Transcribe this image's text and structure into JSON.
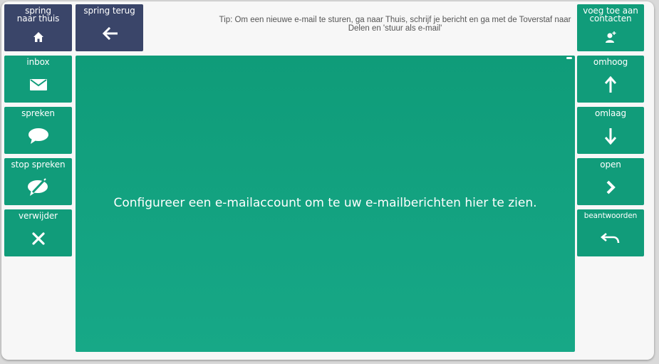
{
  "top_left": [
    {
      "label": "spring naar thuis",
      "icon": "home-icon"
    },
    {
      "label": "spring terug",
      "icon": "arrow-left-icon"
    }
  ],
  "tip": "Tip: Om een nieuwe e-mail te sturen, ga naar Thuis, schrijf je bericht en ga met de Toverstaf naar Delen en 'stuur als e-mail'",
  "left_buttons": [
    {
      "label": "inbox",
      "icon": "envelope-icon"
    },
    {
      "label": "spreken",
      "icon": "speech-bubble-icon"
    },
    {
      "label": "stop spreken",
      "icon": "speech-bubble-slash-icon"
    },
    {
      "label": "verwijder",
      "icon": "close-icon"
    }
  ],
  "right_buttons": [
    {
      "label": "voeg toe aan contacten",
      "icon": "add-contact-icon"
    },
    {
      "label": "omhoog",
      "icon": "arrow-up-icon"
    },
    {
      "label": "omlaag",
      "icon": "arrow-down-icon"
    },
    {
      "label": "open",
      "icon": "chevron-right-icon"
    },
    {
      "label": "beantwoorden",
      "icon": "reply-icon"
    }
  ],
  "main": {
    "message": "Configureer een e-mailaccount om te uw e-mailberichten hier te zien."
  },
  "colors": {
    "navy": "#3a4569",
    "green": "#119c7a",
    "background": "#f7f7f7"
  }
}
